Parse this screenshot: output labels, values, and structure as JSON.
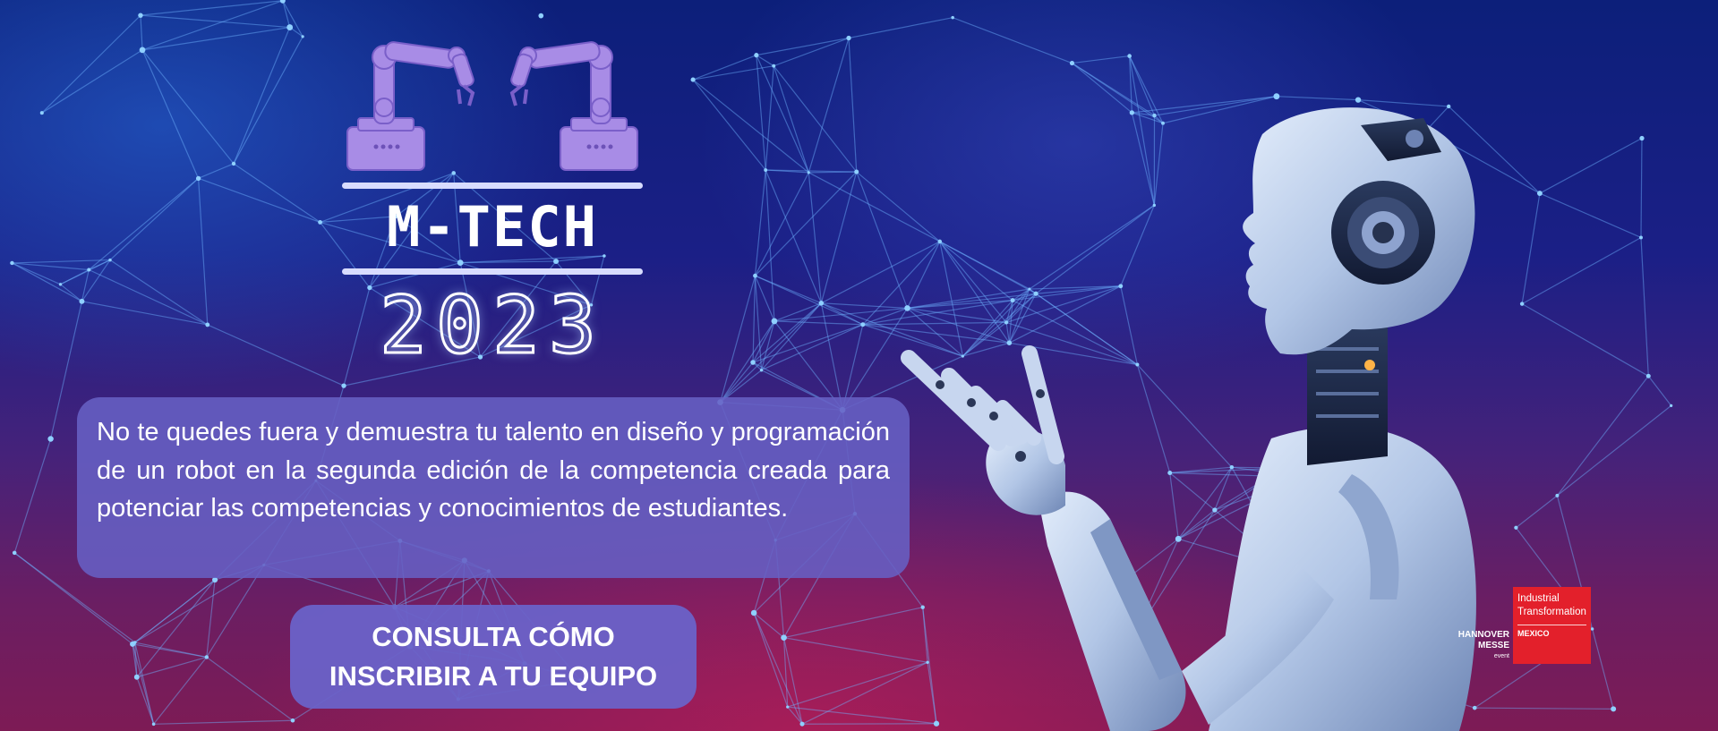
{
  "logo": {
    "title": "M-TECH",
    "year": "2023",
    "icon": "robotic-arms-icon",
    "color": "#a98ce8"
  },
  "description": {
    "text": "No te quedes fuera y demuestra tu talento en diseño y programación de un robot en la segunda edición de la competencia creada para potenciar las competencias y conocimientos de estudiantes."
  },
  "cta": {
    "line1": "CONSULTA CÓMO",
    "line2": "INSCRIBIR A TU EQUIPO"
  },
  "partners": {
    "hannover_line1": "HANNOVER",
    "hannover_line2": "MESSE",
    "hannover_sub": "event",
    "it_line1": "Industrial",
    "it_line2": "Transformation",
    "it_country": "MEXICO",
    "it_color": "#e3202b"
  },
  "colors": {
    "panel": "#6660c4",
    "network_lines": "#5aa8ff",
    "robot": "#b8cbe8"
  }
}
